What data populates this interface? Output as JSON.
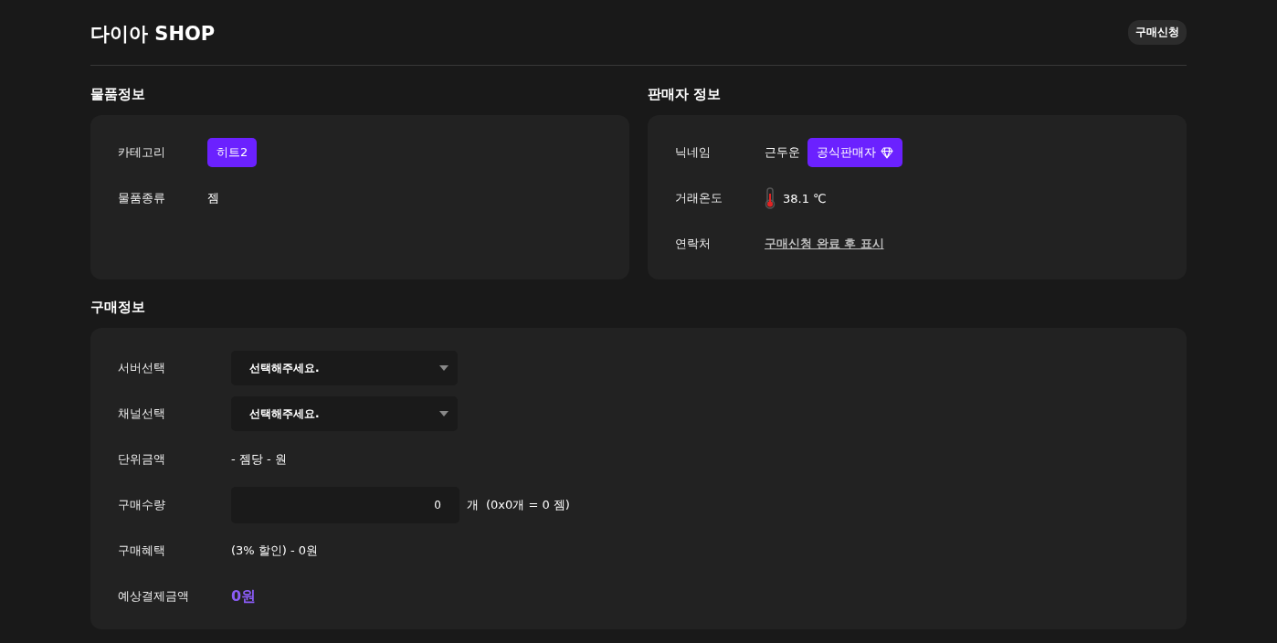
{
  "header": {
    "title": "다이아 SHOP",
    "button": "구매신청"
  },
  "item_info": {
    "heading": "물품정보",
    "rows": [
      {
        "kind": "tag",
        "label": "카테고리",
        "value": "히트2"
      },
      {
        "kind": "text",
        "label": "물품종류",
        "value": "젬"
      }
    ]
  },
  "seller_info": {
    "heading": "판매자 정보",
    "rows": [
      {
        "kind": "seller",
        "label": "닉네임",
        "value": "근두운",
        "badge": "공식판매자"
      },
      {
        "kind": "temperature",
        "label": "거래온도",
        "value": "38.1 ℃"
      },
      {
        "kind": "link",
        "label": "연락처",
        "value": "구매신청 완료 후 표시"
      }
    ]
  },
  "purchase_info": {
    "heading": "구매정보",
    "rows": [
      {
        "kind": "select",
        "label": "서버선택",
        "value": "선택해주세요."
      },
      {
        "kind": "select",
        "label": "채널선택",
        "value": "선택해주세요."
      },
      {
        "kind": "text",
        "label": "단위금액",
        "value": "- 젬당 - 원"
      },
      {
        "kind": "quantity",
        "label": "구매수량",
        "value": "0",
        "suffix": "개",
        "formula": "(0x0개 = 0 젬)"
      },
      {
        "kind": "text",
        "label": "구매혜택",
        "value": "(3% 할인) -  0원"
      },
      {
        "kind": "total",
        "label": "예상결제금액",
        "value": "0원"
      }
    ]
  }
}
